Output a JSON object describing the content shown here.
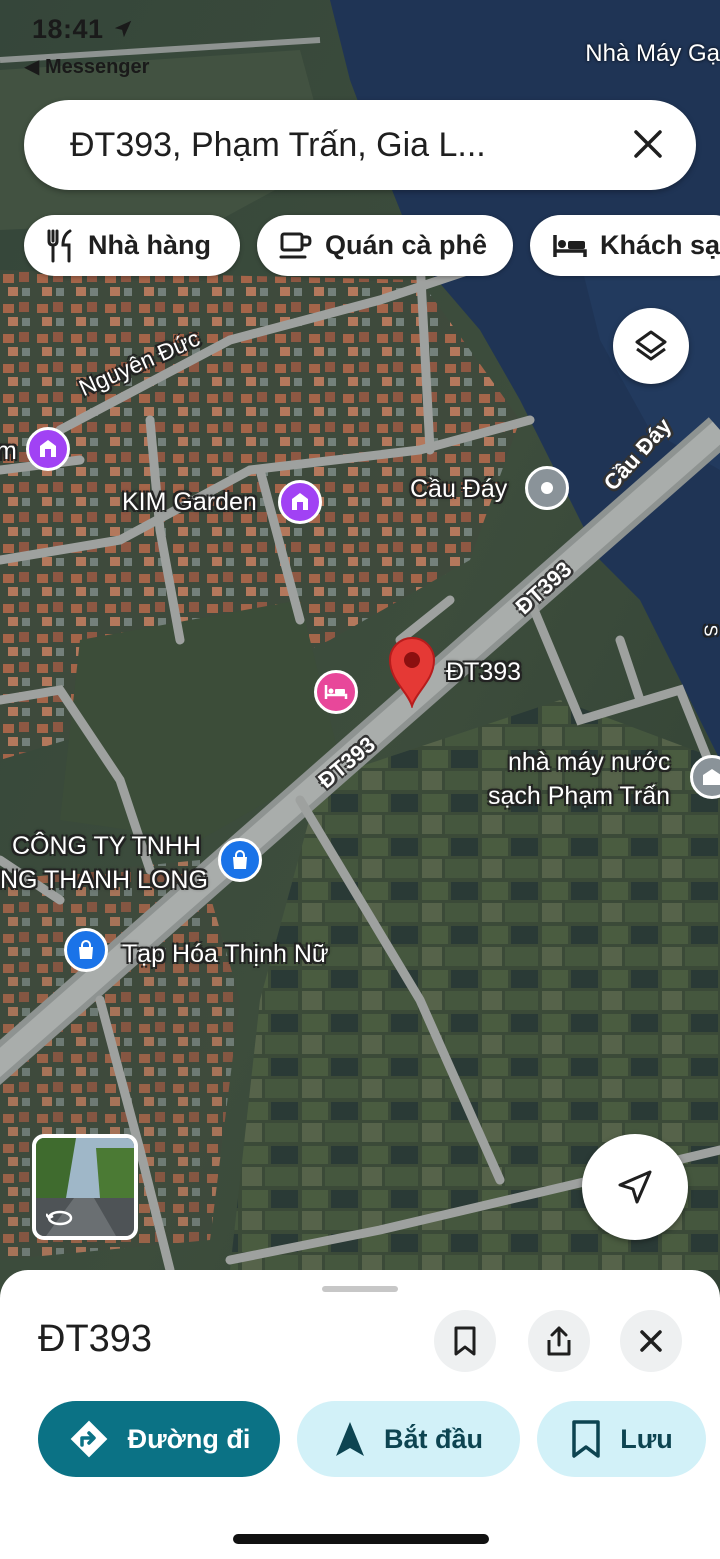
{
  "status_bar": {
    "time": "18:41",
    "back_label": "◀ Messenger",
    "top_right_label": "Nhà Máy Gạ"
  },
  "search": {
    "text": "ĐT393, Phạm Trấn, Gia L..."
  },
  "chips": [
    {
      "label": "Nhà hàng",
      "icon": "restaurant-icon"
    },
    {
      "label": "Quán cà phê",
      "icon": "coffee-icon"
    },
    {
      "label": "Khách sạ",
      "icon": "hotel-icon"
    }
  ],
  "map": {
    "labels": {
      "nguyen_duc": "Nguyên Đức",
      "kim_garden": "KIM Garden",
      "cau_day": "Cầu Đáy",
      "cau_day_road": "Cầu Đáy",
      "dt393_a": "ĐT393",
      "dt393_pin": "ĐT393",
      "dt393_b": "ĐT393",
      "nha_may_nuoc_1": "nhà máy nước",
      "nha_may_nuoc_2": "sạch Phạm Trấn",
      "cong_ty_1": "CÔNG TY TNHH",
      "cong_ty_2": "NG THANH LONG",
      "tap_hoa": "Tạp Hóa Thịnh Nữ",
      "edge_m": "m",
      "edge_s": "S"
    },
    "colors": {
      "pin": "#e53935",
      "shop_poi": "#1a73e8",
      "attraction_poi": "#a142f4",
      "hotel_poi": "#e8479a",
      "gray_poi": "#8a9399"
    }
  },
  "place_sheet": {
    "title": "ĐT393",
    "actions": [
      {
        "label": "Đường đi",
        "icon": "directions-icon"
      },
      {
        "label": "Bắt đầu",
        "icon": "navigation-arrow-icon"
      },
      {
        "label": "Lưu",
        "icon": "bookmark-icon"
      }
    ],
    "accent": "#0b7285"
  }
}
